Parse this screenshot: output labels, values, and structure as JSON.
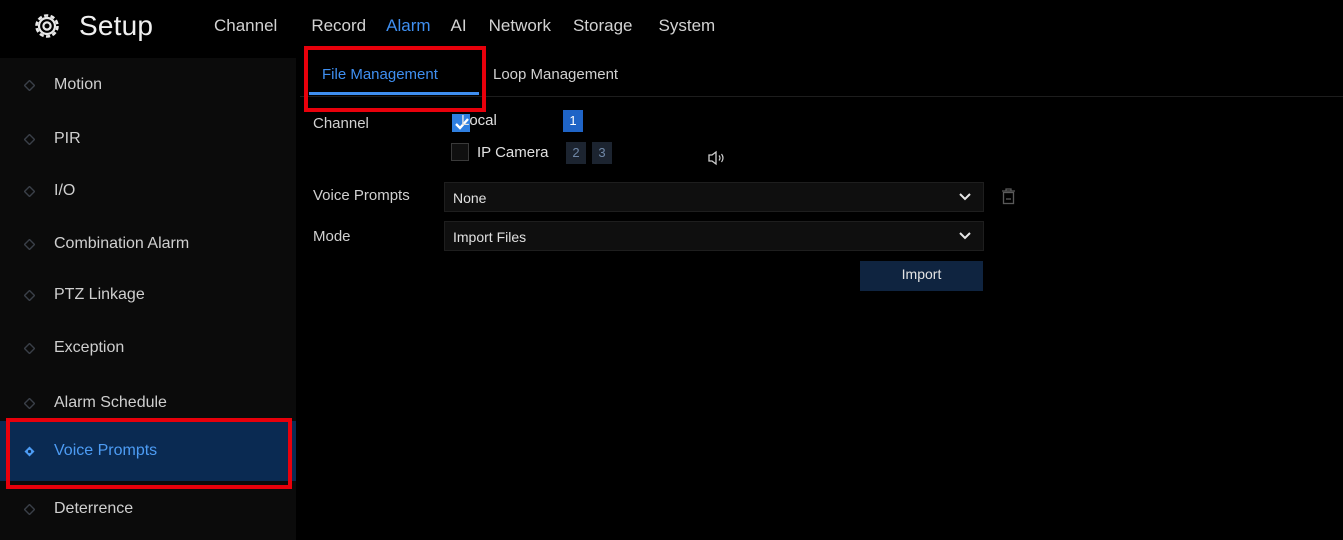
{
  "header": {
    "title": "Setup",
    "logo_icon": "gear-icon",
    "nav": [
      {
        "label": "Channel",
        "active": false
      },
      {
        "label": "Record",
        "active": false
      },
      {
        "label": "Alarm",
        "active": true
      },
      {
        "label": "AI",
        "active": false
      },
      {
        "label": "Network",
        "active": false
      },
      {
        "label": "Storage",
        "active": false
      },
      {
        "label": "System",
        "active": false
      }
    ]
  },
  "sidebar": {
    "items": [
      {
        "label": "Motion"
      },
      {
        "label": "PIR"
      },
      {
        "label": "I/O"
      },
      {
        "label": "Combination Alarm"
      },
      {
        "label": "PTZ Linkage"
      },
      {
        "label": "Exception"
      },
      {
        "label": "Alarm Schedule"
      },
      {
        "label": "Voice Prompts",
        "active": true
      },
      {
        "label": "Deterrence"
      }
    ]
  },
  "tabs": [
    {
      "label": "File Management",
      "active": true
    },
    {
      "label": "Loop Management",
      "active": false
    }
  ],
  "form": {
    "channel": {
      "label": "Channel",
      "local": {
        "label": "Local",
        "checked": true,
        "channels": [
          "1"
        ]
      },
      "ip_camera": {
        "label": "IP Camera",
        "checked": false,
        "channels": [
          "2",
          "3"
        ]
      },
      "speaker_icon": "speaker-icon"
    },
    "voice_prompts": {
      "label": "Voice Prompts",
      "value": "None",
      "delete_icon": "trash-icon"
    },
    "mode": {
      "label": "Mode",
      "value": "Import Files"
    },
    "import_button": "Import"
  },
  "colors": {
    "accent": "#3f8ff0",
    "highlight": "#e8000b",
    "active_bg": "#0a2a52"
  }
}
